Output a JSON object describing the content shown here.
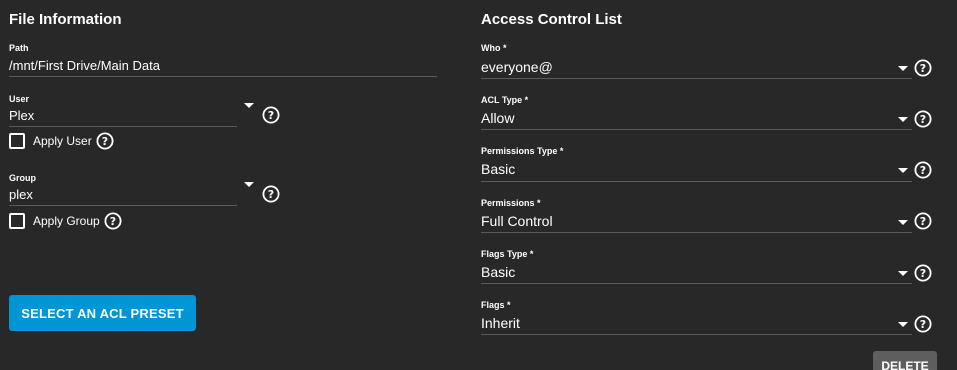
{
  "file_info": {
    "title": "File Information",
    "path": {
      "label": "Path",
      "value": "/mnt/First Drive/Main Data"
    },
    "user": {
      "label": "User",
      "value": "Plex"
    },
    "apply_user": {
      "label": "Apply User",
      "checked": false
    },
    "group": {
      "label": "Group",
      "value": "plex"
    },
    "apply_group": {
      "label": "Apply Group",
      "checked": false
    },
    "preset_button": "SELECT AN ACL PRESET"
  },
  "acl": {
    "title": "Access Control List",
    "who": {
      "label": "Who *",
      "value": "everyone@"
    },
    "acl_type": {
      "label": "ACL Type *",
      "value": "Allow"
    },
    "permissions_type": {
      "label": "Permissions Type *",
      "value": "Basic"
    },
    "permissions": {
      "label": "Permissions *",
      "value": "Full Control"
    },
    "flags_type": {
      "label": "Flags Type *",
      "value": "Basic"
    },
    "flags": {
      "label": "Flags *",
      "value": "Inherit"
    },
    "delete_button": "DELETE"
  },
  "colors": {
    "background": "#282828",
    "accent": "#0095d5",
    "underline": "#5a5a5a",
    "delete_bg": "#5e5e5e"
  },
  "icons": {
    "help": "help-circle-icon",
    "dropdown": "caret-down-icon",
    "checkbox": "checkbox-unchecked"
  }
}
